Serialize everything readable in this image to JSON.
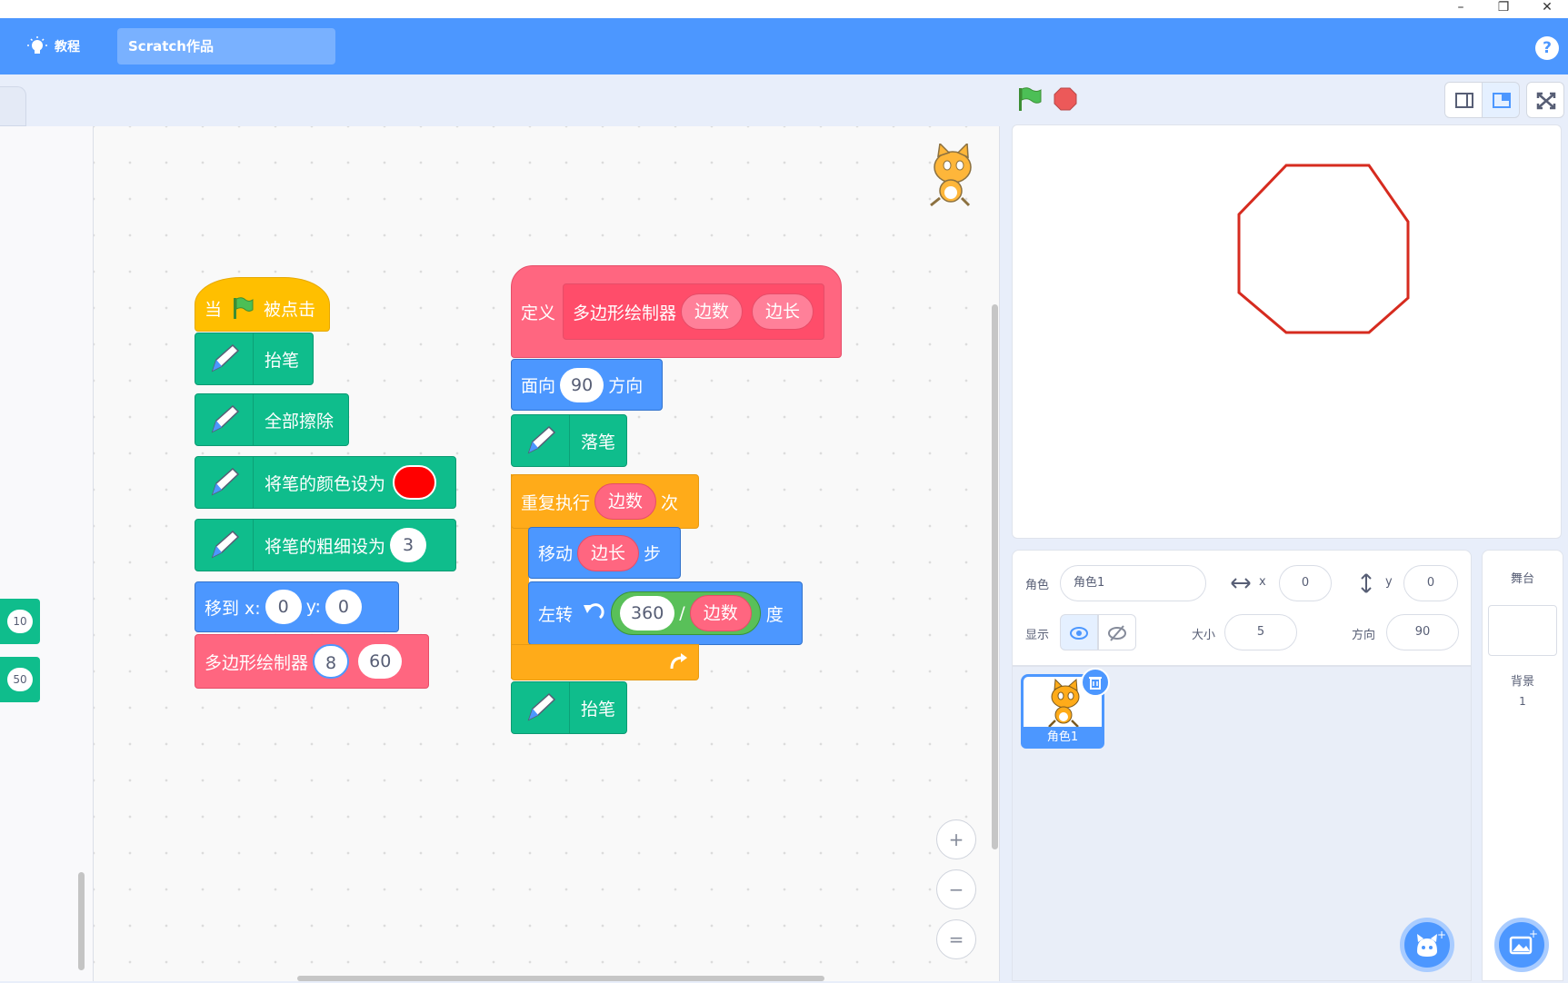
{
  "window": {
    "minimize": "–",
    "restore": "❐",
    "close": "✕"
  },
  "menubar": {
    "tutorials": "教程",
    "project_title": "Scratch作品",
    "help": "?"
  },
  "palette": {
    "partial_blocks": [
      "10",
      "50"
    ]
  },
  "script_main": {
    "hat_prefix": "当",
    "hat_suffix": "被点击",
    "pen_up": "抬笔",
    "clear": "全部擦除",
    "set_color": "将笔的颜色设为",
    "set_color_value": "#ff0000",
    "set_size": "将笔的粗细设为",
    "set_size_value": "3",
    "goto_label": "移到 x:",
    "goto_x": "0",
    "goto_y_label": "y:",
    "goto_y": "0",
    "call_label": "多边形绘制器",
    "call_arg1": "8",
    "call_arg2": "60"
  },
  "script_define": {
    "define_label": "定义",
    "proc_name": "多边形绘制器",
    "param1": "边数",
    "param2": "边长",
    "point_label": "面向",
    "point_value": "90",
    "point_suffix": "方向",
    "pen_down": "落笔",
    "repeat_label": "重复执行",
    "repeat_arg": "边数",
    "repeat_suffix": "次",
    "move_label": "移动",
    "move_arg": "边长",
    "move_suffix": "步",
    "turn_label": "左转",
    "turn_num": "360",
    "turn_div": "/",
    "turn_arg": "边数",
    "turn_suffix": "度",
    "pen_up": "抬笔"
  },
  "zoom": {
    "in": "+",
    "out": "−",
    "reset": "="
  },
  "sprite_info": {
    "sprite_label": "角色",
    "sprite_name": "角色1",
    "x_label": "x",
    "x_value": "0",
    "y_label": "y",
    "y_value": "0",
    "show_label": "显示",
    "size_label": "大小",
    "size_value": "5",
    "direction_label": "方向",
    "direction_value": "90"
  },
  "sprite_list": {
    "items": [
      {
        "name": "角色1"
      }
    ]
  },
  "stage_panel": {
    "title": "舞台",
    "backdrops_label": "背景",
    "backdrops_count": "1"
  },
  "stage": {
    "pen_color": "#d62b1f",
    "drawn_shape": "octagon"
  },
  "colors": {
    "menubar": "#4c97ff",
    "pen": "#0fbd8c",
    "motion": "#4c97ff",
    "control": "#ffab19",
    "custom": "#ff6680",
    "events": "#ffbf00",
    "operators": "#59c059"
  }
}
